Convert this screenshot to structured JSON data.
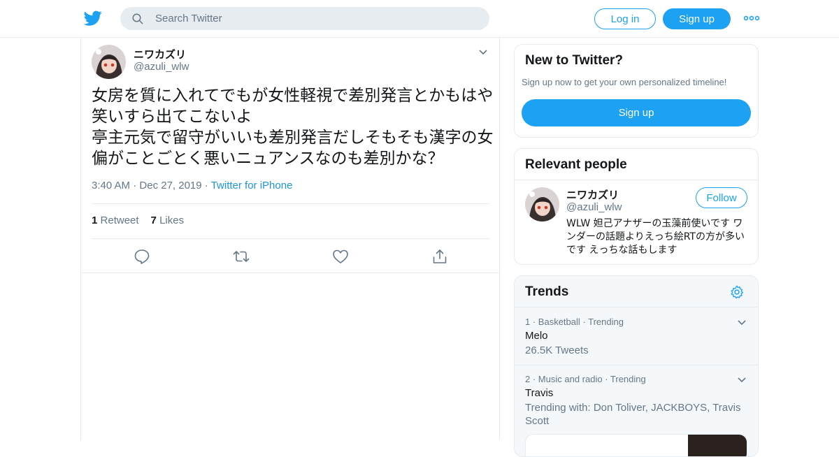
{
  "header": {
    "search_placeholder": "Search Twitter",
    "login_label": "Log in",
    "signup_label": "Sign up"
  },
  "tweet": {
    "author_name": "ニワカズリ",
    "author_handle": "@azuli_wlw",
    "text": "女房を質に入れてでもが女性軽視で差別発言とかもはや笑いすら出てこないよ\n亭主元気で留守がいいも差別発言だしそもそも漢字の女偏がことごとく悪いニュアンスなのも差別かな？",
    "time": "3:40 AM",
    "date": "Dec 27, 2019",
    "source": "Twitter for iPhone",
    "retweet_count": "1",
    "retweet_label": "Retweet",
    "like_count": "7",
    "like_label": "Likes"
  },
  "sidebar": {
    "new_to_twitter": {
      "title": "New to Twitter?",
      "subtitle": "Sign up now to get your own personalized timeline!",
      "button": "Sign up"
    },
    "relevant_people": {
      "title": "Relevant people",
      "name": "ニワカズリ",
      "handle": "@azuli_wlw",
      "follow_label": "Follow",
      "bio": "WLW 妲己アナザーの玉藻前使いです ワンダーの話題よりえっち絵RTの方が多いです えっちな話もします"
    },
    "trends": {
      "title": "Trends",
      "items": [
        {
          "rank": "1",
          "category": "Basketball",
          "status": "Trending",
          "name": "Melo",
          "count": "26.5K Tweets"
        },
        {
          "rank": "2",
          "category": "Music and radio",
          "status": "Trending",
          "name": "Travis",
          "count": "Trending with: Don Toliver, JACKBOYS, Travis Scott"
        }
      ]
    }
  },
  "colors": {
    "brand": "#1da1f2",
    "link": "#1b95e0",
    "muted": "#657786",
    "border": "#e6ecf0"
  }
}
